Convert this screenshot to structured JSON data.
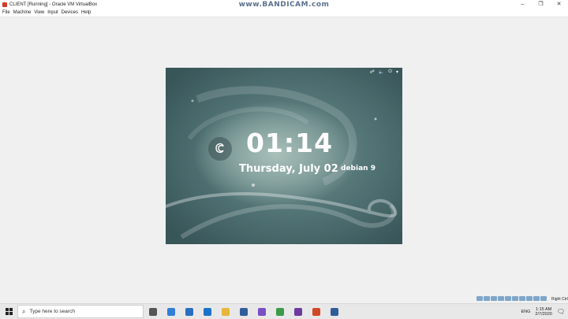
{
  "window": {
    "title": "CLIENT [Running] - Oracle VM VirtualBox",
    "watermark": "www.BANDICAM.com",
    "controls": [
      "–",
      "❐",
      "✕"
    ]
  },
  "menu": {
    "items": [
      "File",
      "Machine",
      "View",
      "Input",
      "Devices",
      "Help"
    ]
  },
  "vm": {
    "topbar_icons": [
      "network-icon",
      "volume-icon",
      "power-icon",
      "chevron-down-icon"
    ],
    "time": "01:14",
    "date": "Thursday, July 02",
    "os_label": "debian 9"
  },
  "taskbar": {
    "search_placeholder": "Type here to search",
    "pinned": [
      {
        "name": "task-view-icon",
        "color": "#555555"
      },
      {
        "name": "edge-icon",
        "color": "#2f7fd6"
      },
      {
        "name": "store-icon",
        "color": "#2a6ebd"
      },
      {
        "name": "mail-icon",
        "color": "#1a73c8"
      },
      {
        "name": "explorer-icon",
        "color": "#e7b63b"
      },
      {
        "name": "virtualbox-icon",
        "color": "#2f5e9a"
      },
      {
        "name": "visual-studio-icon",
        "color": "#7a4ec4"
      },
      {
        "name": "chrome-icon",
        "color": "#3a9a4a"
      },
      {
        "name": "onenote-icon",
        "color": "#6d3aa0"
      },
      {
        "name": "powerpoint-icon",
        "color": "#d24726"
      },
      {
        "name": "virtualbox-vm-icon",
        "color": "#2f5e9a"
      }
    ],
    "tray": {
      "language": "ENG",
      "time": "1:15 AM",
      "date": "2/7/2020",
      "host_key": "Right Ctrl"
    }
  }
}
